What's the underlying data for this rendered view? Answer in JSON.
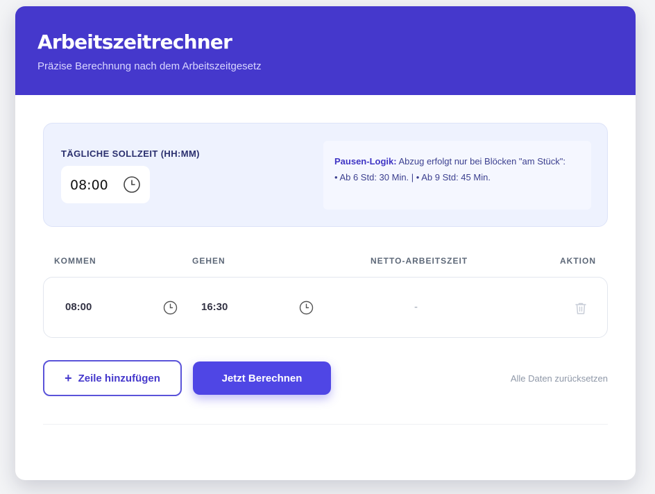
{
  "header": {
    "title": "Arbeitszeitrechner",
    "subtitle": "Präzise Berechnung nach dem Arbeitszeitgesetz"
  },
  "config": {
    "target_label": "TÄGLICHE SOLLZEIT (HH:MM)",
    "target_value": "08:00",
    "info_strong": "Pausen-Logik:",
    "info_text": " Abzug erfolgt nur bei Blöcken \"am Stück\":",
    "info_line2": "• Ab 6 Std: 30 Min. | • Ab 9 Std: 45 Min."
  },
  "table": {
    "columns": [
      "KOMMEN",
      "GEHEN",
      "NETTO-ARBEITSZEIT",
      "AKTION"
    ],
    "rows": [
      {
        "kommen": "08:00",
        "gehen": "16:30",
        "netto": "-"
      }
    ]
  },
  "actions": {
    "add_label": "Zeile hinzufügen",
    "add_icon": "+",
    "calc_label": "Jetzt Berechnen",
    "reset_label": "Alle Daten zurücksetzen"
  },
  "colors": {
    "brand": "#4538cc",
    "primary_button": "#4f46e5",
    "panel_bg": "#eef2fe"
  }
}
